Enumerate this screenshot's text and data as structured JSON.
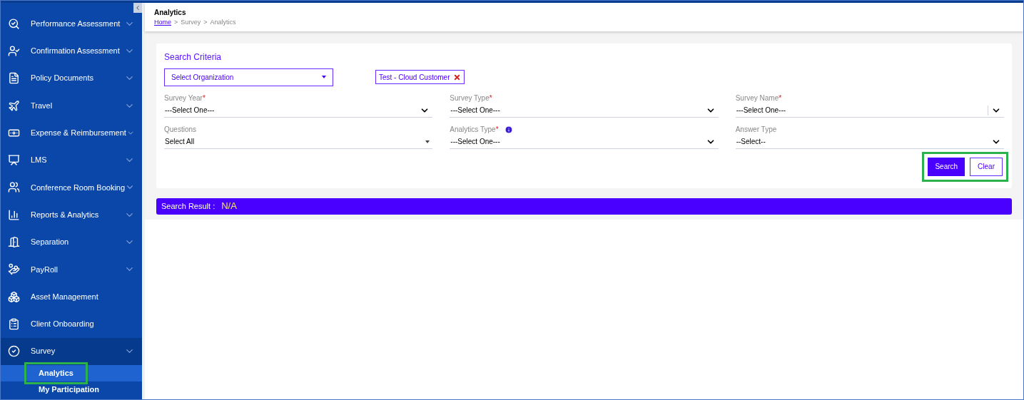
{
  "sidebar": {
    "items": [
      {
        "label": "Performance Assessment",
        "expandable": true,
        "expanded": false
      },
      {
        "label": "Confirmation Assessment",
        "expandable": true,
        "expanded": false
      },
      {
        "label": "Policy Documents",
        "expandable": true,
        "expanded": false
      },
      {
        "label": "Travel",
        "expandable": true,
        "expanded": false
      },
      {
        "label": "Expense & Reimbursement",
        "expandable": true,
        "expanded": false
      },
      {
        "label": "LMS",
        "expandable": true,
        "expanded": false
      },
      {
        "label": "Conference Room Booking",
        "expandable": true,
        "expanded": false
      },
      {
        "label": "Reports & Analytics",
        "expandable": true,
        "expanded": false
      },
      {
        "label": "Separation",
        "expandable": true,
        "expanded": false
      },
      {
        "label": "PayRoll",
        "expandable": true,
        "expanded": false
      },
      {
        "label": "Asset Management",
        "expandable": false,
        "expanded": false
      },
      {
        "label": "Client Onboarding",
        "expandable": false,
        "expanded": false
      },
      {
        "label": "Survey",
        "expandable": true,
        "expanded": true,
        "children": [
          {
            "label": "Analytics",
            "selected": true,
            "highlighted": true
          },
          {
            "label": "My Participation",
            "selected": false,
            "highlighted": false
          }
        ]
      }
    ]
  },
  "header": {
    "title": "Analytics",
    "separator": ">",
    "breadcrumb": [
      {
        "label": "Home",
        "link": true
      },
      {
        "label": "Survey",
        "link": false
      },
      {
        "label": "Analytics",
        "link": false
      }
    ]
  },
  "search_criteria": {
    "title": "Search Criteria",
    "required_mark": "*",
    "organization": {
      "placeholder": "Select Organization"
    },
    "tags": [
      {
        "label": "Test - Cloud Customer"
      }
    ],
    "fields": [
      {
        "label": "Survey Year",
        "required": true,
        "info": false,
        "value": "---Select One---",
        "kind": "chevron"
      },
      {
        "label": "Survey Type",
        "required": true,
        "info": false,
        "value": "---Select One---",
        "kind": "chevron"
      },
      {
        "label": "Survey Name",
        "required": true,
        "info": false,
        "value": "---Select One---",
        "kind": "divided"
      },
      {
        "label": "Questions",
        "required": false,
        "info": false,
        "value": "Select All",
        "kind": "triangle"
      },
      {
        "label": "Analytics Type",
        "required": true,
        "info": true,
        "value": "---Select One---",
        "kind": "chevron"
      },
      {
        "label": "Answer Type",
        "required": false,
        "info": false,
        "value": "--Select--",
        "kind": "chevron"
      }
    ],
    "buttons": [
      {
        "label": "Search",
        "kind": "primary"
      },
      {
        "label": "Clear",
        "kind": "outline"
      }
    ],
    "buttons_highlighted": true
  },
  "search_result": {
    "label": "Search Result :",
    "value": "N/A"
  }
}
